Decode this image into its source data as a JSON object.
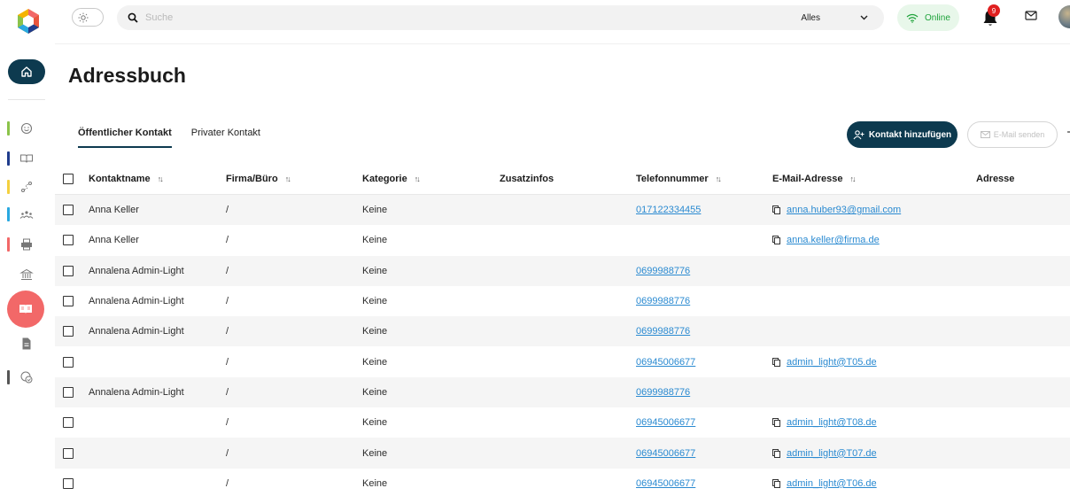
{
  "colors": {
    "brand_dark": "#0d3a4f",
    "active": "#f26868",
    "online_green": "#1fa33b",
    "link": "#2a8ad1",
    "badge_red": "#e02020"
  },
  "sidebar": {
    "items": [
      {
        "icon": "smiley-icon",
        "bar_color": "#8bc34a"
      },
      {
        "icon": "book-open-icon",
        "bar_color": "#1f3c8c"
      },
      {
        "icon": "route-icon",
        "bar_color": "#f4d03f"
      },
      {
        "icon": "people-icon",
        "bar_color": "#29a8e0"
      },
      {
        "icon": "printer-icon",
        "bar_color": "#f26868"
      },
      {
        "icon": "bank-icon",
        "bar_color": ""
      },
      {
        "icon": "address-book-icon",
        "bar_color": "",
        "active": true
      },
      {
        "icon": "document-icon",
        "bar_color": ""
      },
      {
        "icon": "chart-pie-icon",
        "bar_color": "#555555"
      }
    ]
  },
  "header": {
    "search": {
      "placeholder": "Suche",
      "scope": "Alles"
    },
    "status": "Online",
    "notifications": "9"
  },
  "page": {
    "title": "Adressbuch",
    "tabs": [
      "Öffentlicher Kontakt",
      "Privater Kontakt"
    ],
    "actions": {
      "add_contact": "Kontakt hinzufügen",
      "send_mail": "E-Mail senden"
    }
  },
  "table": {
    "columns": {
      "name": "Kontaktname",
      "firma": "Firma/Büro",
      "kategorie": "Kategorie",
      "zusatz": "Zusatzinfos",
      "telefon": "Telefonnummer",
      "email": "E-Mail-Adresse",
      "adresse": "Adresse"
    },
    "rows": [
      {
        "name": "Anna Keller",
        "firma": "/",
        "kategorie": "Keine",
        "telefon": "017122334455",
        "email": "anna.huber93@gmail.com"
      },
      {
        "name": "Anna Keller",
        "firma": "/",
        "kategorie": "Keine",
        "telefon": "",
        "email": "anna.keller@firma.de"
      },
      {
        "name": "Annalena Admin-Light",
        "firma": "/",
        "kategorie": "Keine",
        "telefon": "0699988776",
        "email": ""
      },
      {
        "name": "Annalena Admin-Light",
        "firma": "/",
        "kategorie": "Keine",
        "telefon": "0699988776",
        "email": ""
      },
      {
        "name": "Annalena Admin-Light",
        "firma": "/",
        "kategorie": "Keine",
        "telefon": "0699988776",
        "email": ""
      },
      {
        "name": "",
        "firma": "/",
        "kategorie": "Keine",
        "telefon": "06945006677",
        "email": "admin_light@T05.de"
      },
      {
        "name": "Annalena Admin-Light",
        "firma": "/",
        "kategorie": "Keine",
        "telefon": "0699988776",
        "email": ""
      },
      {
        "name": "",
        "firma": "/",
        "kategorie": "Keine",
        "telefon": "06945006677",
        "email": "admin_light@T08.de"
      },
      {
        "name": "",
        "firma": "/",
        "kategorie": "Keine",
        "telefon": "06945006677",
        "email": "admin_light@T07.de"
      },
      {
        "name": "",
        "firma": "/",
        "kategorie": "Keine",
        "telefon": "06945006677",
        "email": "admin_light@T06.de"
      }
    ]
  }
}
